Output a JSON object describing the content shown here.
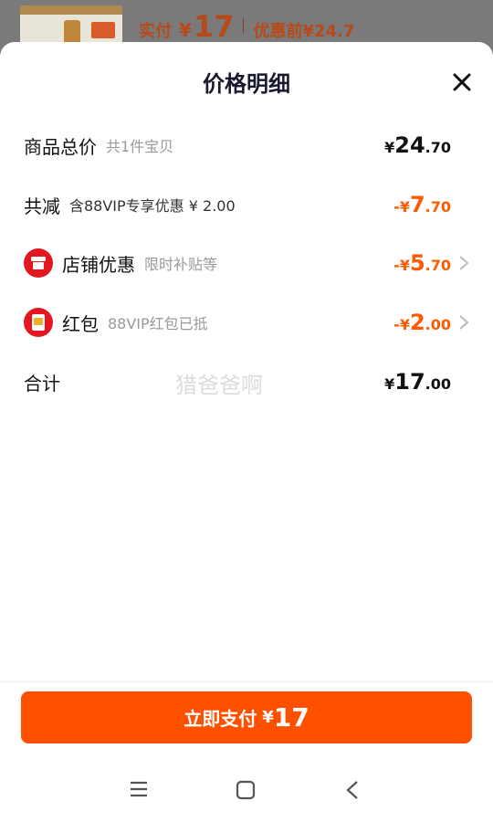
{
  "background_strip": {
    "price_label": "实付",
    "currency": "¥",
    "price": "17",
    "pre_label": "优惠前",
    "pre_price": "¥24.7"
  },
  "sheet": {
    "title": "价格明细"
  },
  "rows": {
    "total": {
      "label": "商品总价",
      "note": "共1件宝贝",
      "currency": "¥",
      "int": "24",
      "dec": ".70"
    },
    "discount": {
      "label": "共减",
      "note": "含88VIP专享优惠 ¥ 2.00",
      "prefix": "-¥",
      "int": "7",
      "dec": ".70"
    },
    "store": {
      "label": "店铺优惠",
      "note": "限时补贴等",
      "prefix": "-¥",
      "int": "5",
      "dec": ".70"
    },
    "redpacket": {
      "label": "红包",
      "note": "88VIP红包已抵",
      "prefix": "-¥",
      "int": "2",
      "dec": ".00"
    },
    "sum": {
      "label": "合计",
      "currency": "¥",
      "int": "17",
      "dec": ".00"
    }
  },
  "watermark": "猎爸爸啊",
  "pay_button": {
    "label": "立即支付",
    "currency": "¥",
    "amount": "17"
  },
  "colors": {
    "accent": "#ff5000",
    "discount": "#ff5a00",
    "icon_red": "#e4161f"
  },
  "icons": [
    "close-icon",
    "store-icon",
    "red-packet-icon",
    "chevron-right-icon",
    "menu-icon",
    "home-icon",
    "back-icon"
  ]
}
